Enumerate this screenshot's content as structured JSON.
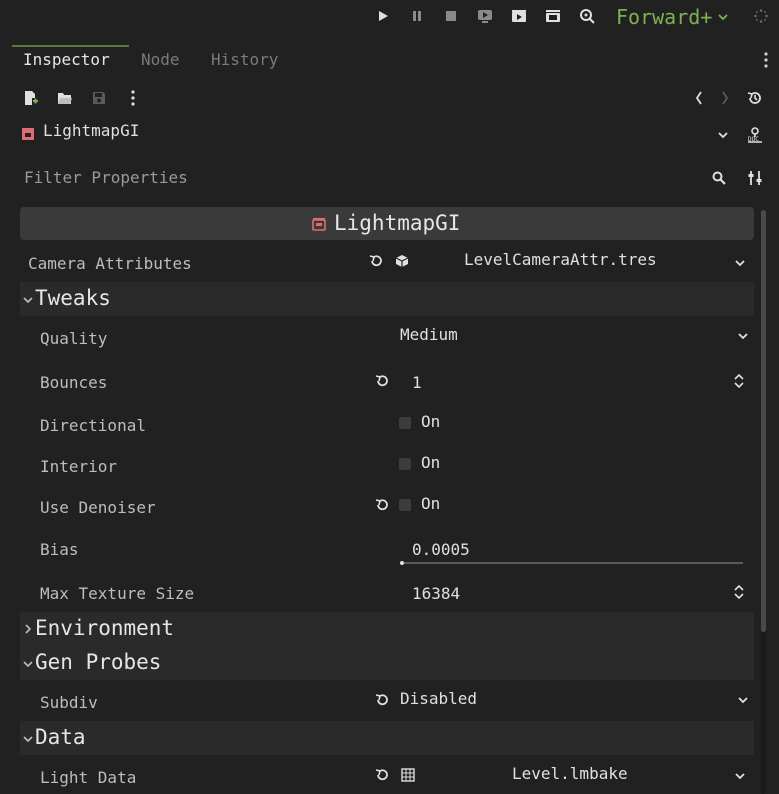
{
  "toolbar": {
    "renderer": "Forward+",
    "icons": [
      "play-icon",
      "pause-icon",
      "stop-icon",
      "play-scene-icon",
      "play-custom-scene-icon",
      "movie-icon",
      "remote-debug-icon",
      "spinner-icon"
    ]
  },
  "tabs": [
    {
      "label": "Inspector",
      "active": true
    },
    {
      "label": "Node",
      "active": false
    },
    {
      "label": "History",
      "active": false
    }
  ],
  "object": {
    "name": "LightmapGI",
    "icon_color": "#e06c75"
  },
  "filter": {
    "placeholder": "Filter Properties"
  },
  "header": {
    "title": "LightmapGI"
  },
  "properties": {
    "camera_attributes": {
      "label": "Camera Attributes",
      "value": "LevelCameraAttr.tres"
    },
    "tweaks": {
      "title": "Tweaks",
      "expanded": true,
      "quality": {
        "label": "Quality",
        "value": "Medium"
      },
      "bounces": {
        "label": "Bounces",
        "value": "1"
      },
      "directional": {
        "label": "Directional",
        "checkbox": "On",
        "checked": false
      },
      "interior": {
        "label": "Interior",
        "checkbox": "On",
        "checked": false
      },
      "use_denoiser": {
        "label": "Use Denoiser",
        "checkbox": "On",
        "checked": false
      },
      "bias": {
        "label": "Bias",
        "value": "0.0005"
      },
      "max_texture_size": {
        "label": "Max Texture Size",
        "value": "16384"
      }
    },
    "environment": {
      "title": "Environment",
      "expanded": false
    },
    "gen_probes": {
      "title": "Gen Probes",
      "expanded": true,
      "subdiv": {
        "label": "Subdiv",
        "value": "Disabled"
      }
    },
    "data": {
      "title": "Data",
      "expanded": true,
      "light_data": {
        "label": "Light Data",
        "value": "Level.lmbake"
      }
    }
  },
  "colors": {
    "accent": "#7fb053",
    "background": "#212121",
    "section": "#2a2a2a"
  }
}
